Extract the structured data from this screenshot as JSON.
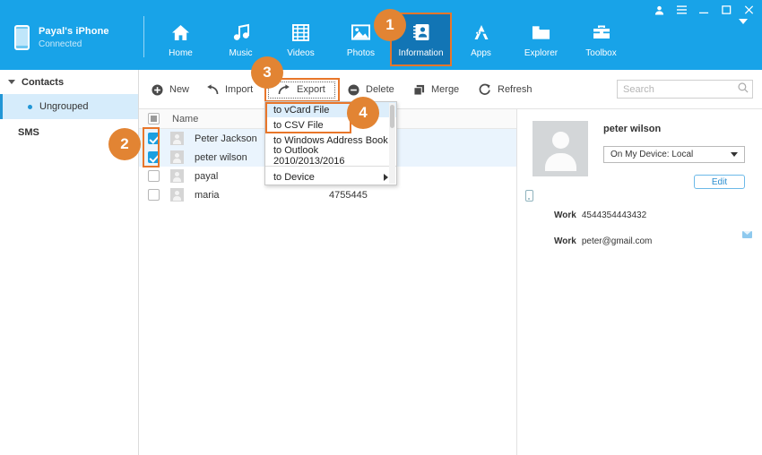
{
  "window": {
    "controls": [
      {
        "name": "account-icon",
        "glyph": "user"
      },
      {
        "name": "menu-icon",
        "glyph": "menu"
      },
      {
        "name": "minimize-button",
        "glyph": "minimize"
      },
      {
        "name": "maximize-button",
        "glyph": "maximize"
      },
      {
        "name": "close-button",
        "glyph": "close"
      }
    ]
  },
  "device": {
    "name": "Payal's iPhone",
    "status": "Connected",
    "icon": "iphone-icon"
  },
  "nav": {
    "items": [
      {
        "label": "Home",
        "icon": "home-icon",
        "active": false
      },
      {
        "label": "Music",
        "icon": "music-icon",
        "active": false
      },
      {
        "label": "Videos",
        "icon": "video-icon",
        "active": false
      },
      {
        "label": "Photos",
        "icon": "photo-icon",
        "active": false
      },
      {
        "label": "Information",
        "icon": "contacts-icon",
        "active": true
      },
      {
        "label": "Apps",
        "icon": "apps-icon",
        "active": false
      },
      {
        "label": "Explorer",
        "icon": "folder-icon",
        "active": false
      },
      {
        "label": "Toolbox",
        "icon": "toolbox-icon",
        "active": false
      }
    ]
  },
  "sidebar": {
    "group_label": "Contacts",
    "items": [
      {
        "label": "Ungrouped",
        "selected": true
      }
    ],
    "sms_label": "SMS"
  },
  "toolbar": {
    "new_label": "New",
    "import_label": "Import",
    "export_label": "Export",
    "delete_label": "Delete",
    "merge_label": "Merge",
    "refresh_label": "Refresh"
  },
  "search": {
    "placeholder": "Search",
    "value": ""
  },
  "export_menu": {
    "items": [
      {
        "label": "to vCard File",
        "highlighted": true,
        "submenu": false
      },
      {
        "label": "to CSV File",
        "highlighted": false,
        "submenu": false
      },
      {
        "label": "to Windows Address Book",
        "highlighted": false,
        "submenu": false
      },
      {
        "label": "to Outlook 2010/2013/2016",
        "highlighted": false,
        "submenu": false
      }
    ],
    "device_item": {
      "label": "to Device",
      "submenu": true
    }
  },
  "list": {
    "header_name": "Name",
    "rows": [
      {
        "name": "Peter  Jackson",
        "phone": "",
        "checked": true,
        "selected": true
      },
      {
        "name": "peter  wilson",
        "phone": "",
        "checked": true,
        "selected": true
      },
      {
        "name": "payal",
        "phone": "",
        "checked": false,
        "selected": false
      },
      {
        "name": "maria",
        "phone": "4755445",
        "checked": false,
        "selected": false
      }
    ]
  },
  "detail": {
    "name": "peter  wilson",
    "account": "On My Device: Local",
    "edit_label": "Edit",
    "fields": [
      {
        "label": "Work",
        "value": "4544354443432",
        "type": "phone"
      },
      {
        "label": "Work",
        "value": "peter@gmail.com",
        "type": "email"
      }
    ]
  },
  "badges": [
    {
      "number": "1"
    },
    {
      "number": "2"
    },
    {
      "number": "3"
    },
    {
      "number": "4"
    }
  ],
  "colors": {
    "brand_blue": "#18a3e8",
    "active_tab": "#1275b5",
    "accent_orange": "#e28433",
    "highlight_orange": "#e8762a",
    "selection_blue": "#d6ecfb"
  }
}
